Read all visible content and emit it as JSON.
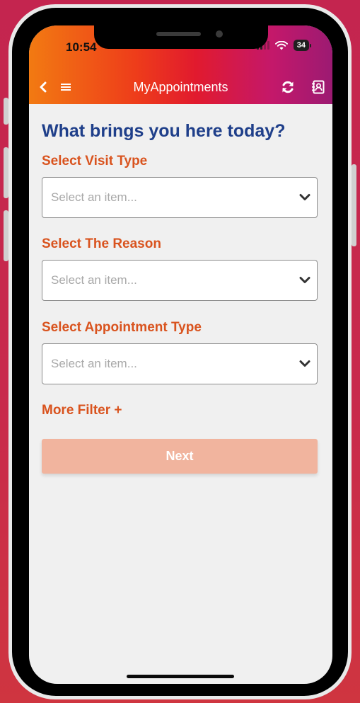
{
  "status_bar": {
    "time": "10:54",
    "battery_level": "34",
    "signal_icon": "signal-bars-icon",
    "wifi_icon": "wifi-icon"
  },
  "nav": {
    "title": "MyAppointments",
    "back_icon": "chevron-left-icon",
    "menu_icon": "hamburger-menu-icon",
    "refresh_icon": "refresh-icon",
    "contacts_icon": "contact-book-icon"
  },
  "form": {
    "title": "What brings you here today?",
    "fields": [
      {
        "label": "Select Visit Type",
        "placeholder": "Select an item..."
      },
      {
        "label": "Select The Reason",
        "placeholder": "Select an item..."
      },
      {
        "label": "Select Appointment Type",
        "placeholder": "Select an item..."
      }
    ],
    "more_filter_label": "More Filter +",
    "next_label": "Next",
    "next_enabled": false
  },
  "colors": {
    "title": "#1f3f8a",
    "label": "#d9531e",
    "next_button_disabled": "#f1b49e",
    "header_gradient_start": "#f27a12",
    "header_gradient_end": "#9c1a72"
  }
}
